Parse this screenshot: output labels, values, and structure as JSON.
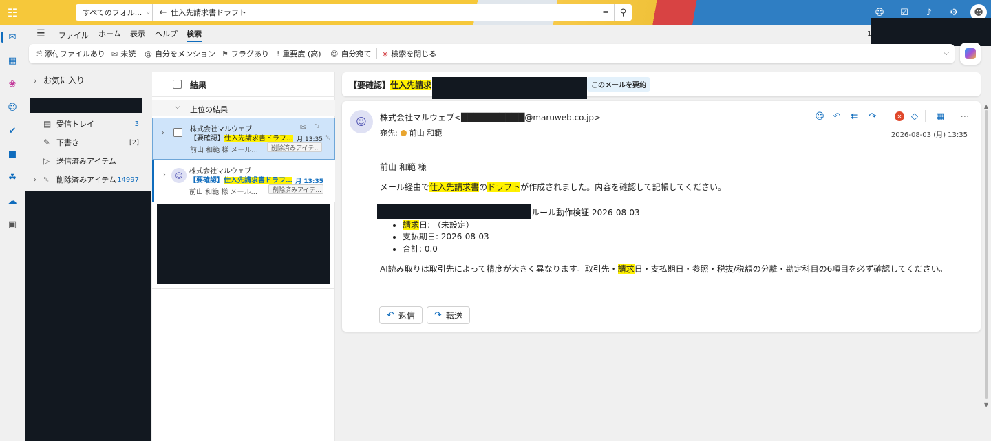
{
  "topbar": {
    "folder_scope": "すべてのフォル...",
    "search_query": "仕入先請求書ドラフト"
  },
  "tabs": {
    "file": "ファイル",
    "home": "ホーム",
    "view": "表示",
    "help": "ヘルプ",
    "search": "検索",
    "right_number": "1"
  },
  "filters": {
    "attachment": "添付ファイルあり",
    "unread": "未読",
    "mentions": "自分をメンション",
    "flagged": "フラグあり",
    "importance": "重要度 (高)",
    "to_me": "自分宛て",
    "close_search": "検索を閉じる"
  },
  "folders": {
    "favorites": "お気に入り",
    "items": [
      {
        "label": "受信トレイ",
        "count": "3"
      },
      {
        "label": "下書き",
        "count": "[2]"
      },
      {
        "label": "送信済みアイテム",
        "count": ""
      },
      {
        "label": "削除済みアイテム",
        "count": "14997"
      }
    ]
  },
  "list": {
    "title": "結果",
    "group": "上位の結果",
    "messages": [
      {
        "sender": "株式会社マルウェブ",
        "subject_prefix": "【要確認】",
        "subject_hl": "仕入先請求書ドラフト",
        "subject_rest": "...",
        "time": "月 13:35",
        "preview": "前山 和範 様 メール...",
        "folder_tag": "削除済みアイテ..."
      },
      {
        "sender": "株式会社マルウェブ",
        "subject_prefix": "【要確認】",
        "subject_hl": "仕入先請求書ドラフト",
        "subject_rest": "...",
        "time": "月 13:35",
        "preview": "前山 和範 様 メール...",
        "folder_tag": "削除済みアイテ..."
      }
    ]
  },
  "reading": {
    "subject_prefix": "【要確認】",
    "subject_hl": "仕入先請求",
    "summarize": "このメールを要約",
    "from": "株式会社マルウェブ<██████████@maruweb.co.jp>",
    "to_label": "宛先:",
    "to_name": "前山 和範",
    "date": "2026-08-03 (月) 13:35",
    "greeting": "前山 和範 様",
    "line1_a": "メール経由で",
    "line1_hl1": "仕入先請求書",
    "line1_b": "の",
    "line1_hl2": "ドラフト",
    "line1_c": "が作成されました。内容を確認して記帳してください。",
    "bullet1": "参照: 【削除してください】自動化ルール動作検証 2026-08-03",
    "bullet2_hl": "請求",
    "bullet2_rest": "日: （未設定）",
    "bullet3": "支払期日: 2026-08-03",
    "bullet4": "合計: 0.0",
    "note_a": "AI読み取りは取引先によって精度が大きく異なります。取引先・",
    "note_hl": "請求",
    "note_b": "日・支払期日・参照・税抜/税額の分離・勘定科目の6項目を必ず確認してください。",
    "reply": "返信",
    "forward": "転送"
  },
  "colors": {
    "accent": "#0f6cbd",
    "highlight": "#fff100",
    "redaction": "#121820"
  }
}
